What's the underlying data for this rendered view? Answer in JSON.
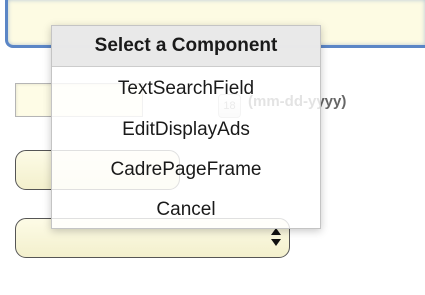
{
  "form": {
    "top_input_value": "",
    "date_input_value": "",
    "calendar_icon_text": "18",
    "date_format_hint": "(mm-dd-yyyy)"
  },
  "popup": {
    "title": "Select a Component",
    "items": [
      {
        "label": "TextSearchField"
      },
      {
        "label": "EditDisplayAds"
      },
      {
        "label": "CadrePageFrame"
      },
      {
        "label": "Cancel"
      }
    ]
  },
  "colors": {
    "input_background": "#fdfbe3",
    "focus_border": "#5b86c6",
    "popup_header": "#e8e8e8"
  },
  "icons": {
    "calendar": "calendar-icon",
    "select_arrows": "up-down-arrows-icon"
  }
}
